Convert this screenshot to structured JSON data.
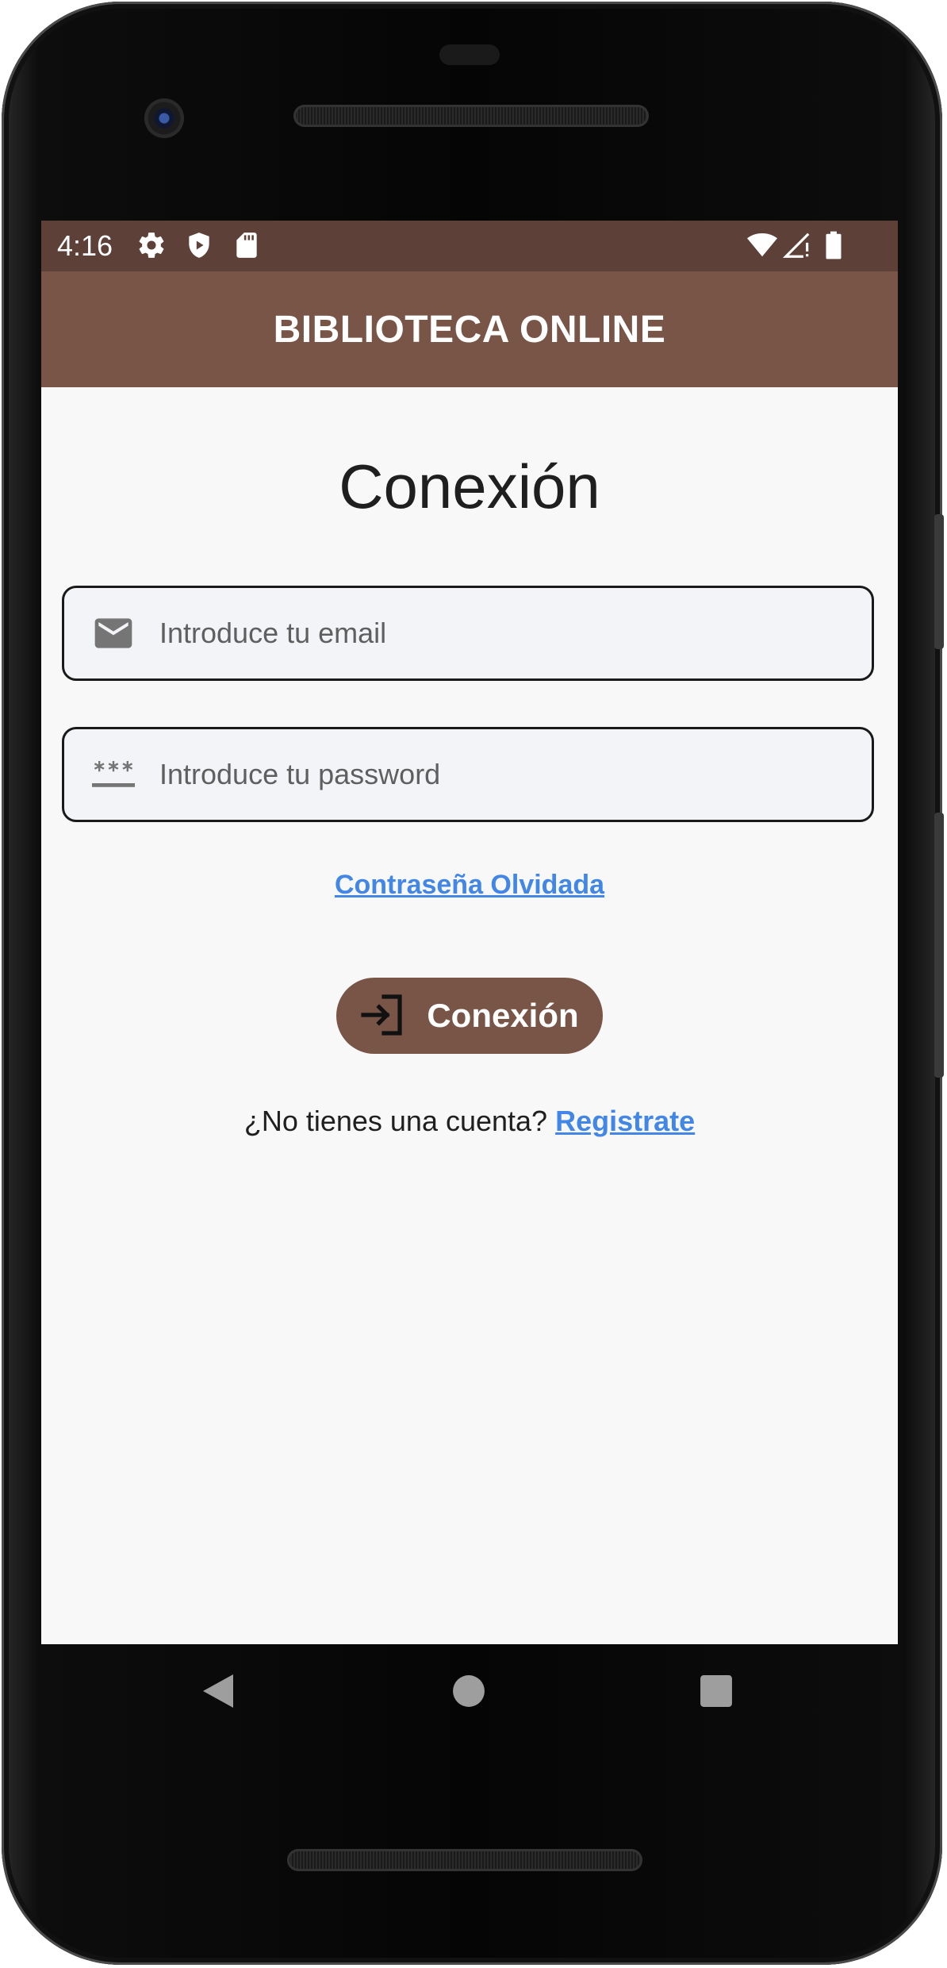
{
  "status_bar": {
    "time": "4:16",
    "left_icons": [
      "gear-icon",
      "shield-play-icon",
      "sd-card-icon"
    ],
    "right_icons": [
      "wifi-icon",
      "cellular-no-signal-icon",
      "battery-icon"
    ]
  },
  "app_bar": {
    "title": "BIBLIOTECA ONLINE"
  },
  "login": {
    "title": "Conexión",
    "email": {
      "placeholder": "Introduce tu email",
      "value": "",
      "icon": "email-icon"
    },
    "password": {
      "placeholder": "Introduce tu password",
      "value": "",
      "icon": "password-icon"
    },
    "forgot_link": "Contraseña Olvidada",
    "button_label": "Conexión",
    "button_icon": "login-icon",
    "register_prompt": "¿No tienes una cuenta?",
    "register_link": "Registrate"
  },
  "nav_bar": {
    "items": [
      "back-icon",
      "home-icon",
      "recents-icon"
    ]
  },
  "colors": {
    "status_bar": "#5d4037",
    "app_bar": "#795548",
    "button": "#795548",
    "link": "#4286e6",
    "background": "#f8f8f8",
    "field_background": "#f2f4f8"
  }
}
